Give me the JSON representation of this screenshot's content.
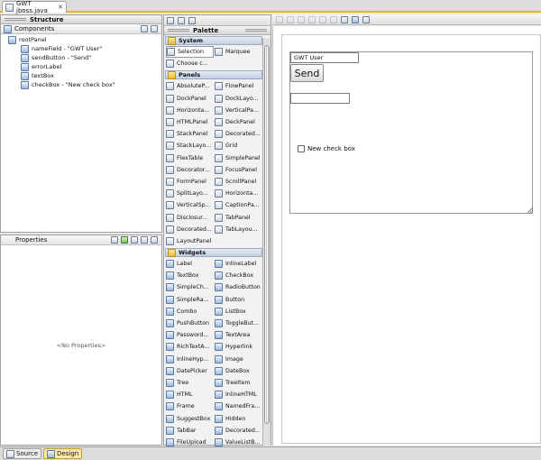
{
  "editor_tab": {
    "label": "GWT jboss.java",
    "close": "✕"
  },
  "structure": {
    "title": "Structure",
    "components_label": "Components",
    "tree": [
      {
        "label": "rootPanel",
        "depth": 0
      },
      {
        "label": "nameField - \"GWT User\"",
        "depth": 1
      },
      {
        "label": "sendButton - \"Send\"",
        "depth": 1
      },
      {
        "label": "errorLabel",
        "depth": 1
      },
      {
        "label": "textBox",
        "depth": 1
      },
      {
        "label": "checkBox - \"New check box\"",
        "depth": 1
      }
    ]
  },
  "properties": {
    "title": "Properties",
    "empty_text": "<No Properties>"
  },
  "palette": {
    "title": "Palette",
    "system": {
      "label": "System",
      "items": [
        "Selection",
        "Marquee",
        "Choose c..."
      ]
    },
    "panels": {
      "label": "Panels",
      "items": [
        "AbsoluteP...",
        "FlowPanel",
        "DockPanel",
        "DockLayo...",
        "Horizonta...",
        "VerticalPa...",
        "HTMLPanel",
        "DeckPanel",
        "StackPanel",
        "Decorated...",
        "StackLayo...",
        "Grid",
        "FlexTable",
        "SimplePanel",
        "Decorator...",
        "FocusPanel",
        "FormPanel",
        "ScrollPanel",
        "SplitLayo...",
        "Horizonta...",
        "VerticalSp...",
        "CaptionPa...",
        "Disclosur...",
        "TabPanel",
        "Decorated...",
        "TabLayou...",
        "LayoutPanel"
      ]
    },
    "widgets": {
      "label": "Widgets",
      "items": [
        "Label",
        "InlineLabel",
        "TextBox",
        "CheckBox",
        "SimpleCh...",
        "RadioButton",
        "SimpleRa...",
        "Button",
        "Combo",
        "ListBox",
        "PushButton",
        "ToggleBut...",
        "Password...",
        "TextArea",
        "RichTextA...",
        "Hyperlink",
        "InlineHyp...",
        "Image",
        "DatePicker",
        "DateBox",
        "Tree",
        "TreeItem",
        "HTML",
        "InlineHTML",
        "Frame",
        "NamedFra...",
        "SuggestBox",
        "Hidden",
        "TabBar",
        "Decorated...",
        "FileUpload",
        "ValueListB..."
      ]
    }
  },
  "canvas": {
    "name_field_value": "GWT User",
    "send_label": "Send",
    "checkbox_label": "New check box"
  },
  "bottom_tabs": [
    {
      "label": "Source"
    },
    {
      "label": "Design",
      "active": true
    }
  ]
}
